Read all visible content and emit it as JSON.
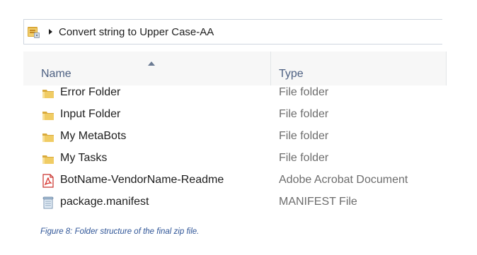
{
  "address_bar": {
    "path_label": "Convert string to Upper Case-AA",
    "location_icon": "folder-location-icon",
    "chevron_icon": "chevron-right-icon"
  },
  "columns": {
    "name_label": "Name",
    "type_label": "Type",
    "sort_indicator": "sort-ascending-icon"
  },
  "files": [
    {
      "name": "Error Folder",
      "type": "File folder",
      "icon": "folder-icon"
    },
    {
      "name": "Input Folder",
      "type": "File folder",
      "icon": "folder-icon"
    },
    {
      "name": "My MetaBots",
      "type": "File folder",
      "icon": "folder-icon"
    },
    {
      "name": "My Tasks",
      "type": "File folder",
      "icon": "folder-icon"
    },
    {
      "name": "BotName-VendorName-Readme",
      "type": "Adobe Acrobat Document",
      "icon": "pdf-icon"
    },
    {
      "name": "package.manifest",
      "type": "MANIFEST File",
      "icon": "manifest-file-icon"
    }
  ],
  "caption": "Figure 8: Folder structure of the final zip file.",
  "colors": {
    "header_text": "#4d6082",
    "type_text": "#6d6d6d",
    "caption_text": "#2f5597",
    "folder_yellow": "#e9c25a",
    "pdf_red": "#d9352f"
  }
}
